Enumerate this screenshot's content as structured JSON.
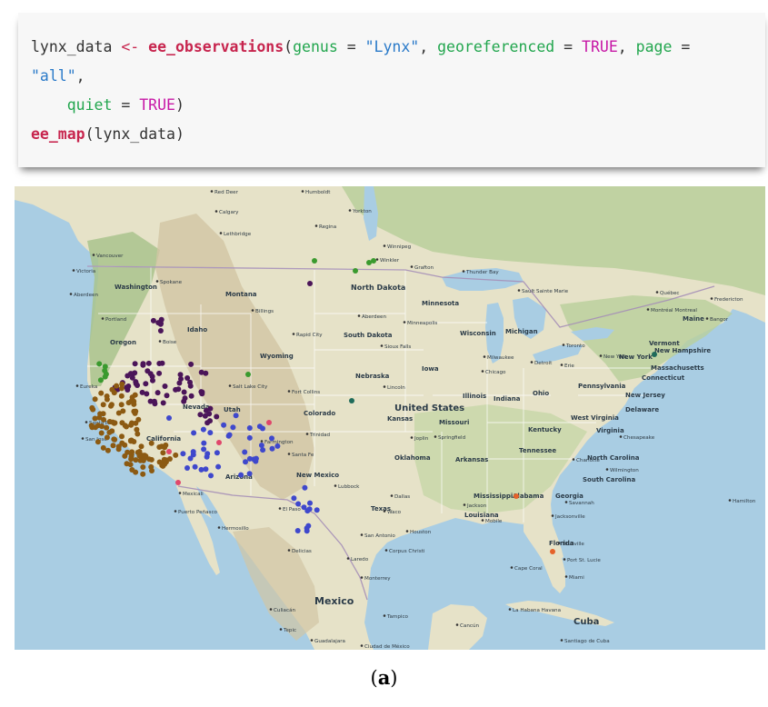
{
  "code": {
    "line1": {
      "var": "lynx_data ",
      "assign": "<-",
      "fn": " ee_observations",
      "open": "(",
      "arg1": "genus",
      "eq1": " = ",
      "val1": "\"Lynx\"",
      "sep1": ", ",
      "arg2": "georeferenced",
      "eq2": " = ",
      "val2": "TRUE",
      "sep2": ", ",
      "arg3": "page",
      "eq3": " ="
    },
    "line2": {
      "val3": "\"all\"",
      "sep": ","
    },
    "line3": {
      "indent": "    ",
      "arg4": "quiet",
      "eq4": " = ",
      "val4": "TRUE",
      "close": ")"
    },
    "line4": {
      "fn": "ee_map",
      "rest": "(lynx_data)"
    }
  },
  "caption": {
    "open": "(",
    "letter": "a",
    "close": ")"
  },
  "map": {
    "colors": {
      "water": "#a9cde3",
      "land": "#e6e2c8",
      "forest": "#b9cf9b",
      "mountain": "#d2c6a4",
      "cluster_purple": "#4b1559",
      "cluster_brown": "#8c5a12",
      "cluster_blue": "#3f48cc",
      "cluster_green": "#3a9a2e",
      "cluster_pink": "#e0476b",
      "cluster_orange": "#e5622a",
      "cluster_teal": "#1f6b5a"
    },
    "country_labels": [
      {
        "id": "us",
        "text": "United States"
      },
      {
        "id": "mexico",
        "text": "Mexico"
      },
      {
        "id": "cuba",
        "text": "Cuba"
      }
    ],
    "state_labels": [
      {
        "id": "washington",
        "text": "Washington"
      },
      {
        "id": "montana",
        "text": "Montana"
      },
      {
        "id": "oregon",
        "text": "Oregon"
      },
      {
        "id": "idaho",
        "text": "Idaho"
      },
      {
        "id": "wyoming",
        "text": "Wyoming"
      },
      {
        "id": "north-dakota",
        "text": "North Dakota"
      },
      {
        "id": "south-dakota",
        "text": "South Dakota"
      },
      {
        "id": "minnesota",
        "text": "Minnesota"
      },
      {
        "id": "wisconsin",
        "text": "Wisconsin"
      },
      {
        "id": "michigan",
        "text": "Michigan"
      },
      {
        "id": "nebraska",
        "text": "Nebraska"
      },
      {
        "id": "iowa",
        "text": "Iowa"
      },
      {
        "id": "illinois",
        "text": "Illinois"
      },
      {
        "id": "indiana",
        "text": "Indiana"
      },
      {
        "id": "ohio",
        "text": "Ohio"
      },
      {
        "id": "pennsylvania",
        "text": "Pennsylvania"
      },
      {
        "id": "new-york",
        "text": "New York"
      },
      {
        "id": "utah",
        "text": "Utah"
      },
      {
        "id": "colorado",
        "text": "Colorado"
      },
      {
        "id": "kansas",
        "text": "Kansas"
      },
      {
        "id": "missouri",
        "text": "Missouri"
      },
      {
        "id": "kentucky",
        "text": "Kentucky"
      },
      {
        "id": "west-virginia",
        "text": "West Virginia"
      },
      {
        "id": "virginia",
        "text": "Virginia"
      },
      {
        "id": "california",
        "text": "California"
      },
      {
        "id": "nevada",
        "text": "Nevada"
      },
      {
        "id": "arizona",
        "text": "Arizona"
      },
      {
        "id": "new-mexico",
        "text": "New Mexico"
      },
      {
        "id": "oklahoma",
        "text": "Oklahoma"
      },
      {
        "id": "arkansas",
        "text": "Arkansas"
      },
      {
        "id": "tennessee",
        "text": "Tennessee"
      },
      {
        "id": "north-carolina",
        "text": "North Carolina"
      },
      {
        "id": "south-carolina",
        "text": "South Carolina"
      },
      {
        "id": "mississippi",
        "text": "Mississippi"
      },
      {
        "id": "alabama",
        "text": "Alabama"
      },
      {
        "id": "georgia",
        "text": "Georgia"
      },
      {
        "id": "texas",
        "text": "Texas"
      },
      {
        "id": "louisiana",
        "text": "Louisiana"
      },
      {
        "id": "florida",
        "text": "Florida"
      },
      {
        "id": "massachusetts",
        "text": "Massachusetts"
      },
      {
        "id": "connecticut",
        "text": "Connecticut"
      },
      {
        "id": "new-jersey",
        "text": "New Jersey"
      },
      {
        "id": "delaware",
        "text": "Delaware"
      },
      {
        "id": "vermont",
        "text": "Vermont"
      },
      {
        "id": "new-hampshire",
        "text": "New Hampshire"
      },
      {
        "id": "maine",
        "text": "Maine"
      }
    ],
    "city_labels": [
      {
        "id": "red-deer",
        "text": "Red Deer"
      },
      {
        "id": "calgary",
        "text": "Calgary"
      },
      {
        "id": "lethbridge",
        "text": "Lethbridge"
      },
      {
        "id": "humboldt",
        "text": "Humboldt"
      },
      {
        "id": "yorkton",
        "text": "Yorkton"
      },
      {
        "id": "regina",
        "text": "Regina"
      },
      {
        "id": "winnipeg",
        "text": "Winnipeg"
      },
      {
        "id": "winkler",
        "text": "Winkler"
      },
      {
        "id": "grafton",
        "text": "Grafton"
      },
      {
        "id": "vancouver",
        "text": "Vancouver"
      },
      {
        "id": "victoria",
        "text": "Victoria"
      },
      {
        "id": "aberdeen-wa",
        "text": "Aberdeen"
      },
      {
        "id": "spokane",
        "text": "Spokane"
      },
      {
        "id": "portland",
        "text": "Portland"
      },
      {
        "id": "billings",
        "text": "Billings"
      },
      {
        "id": "boise",
        "text": "Boise"
      },
      {
        "id": "rapid-city",
        "text": "Rapid City"
      },
      {
        "id": "aberdeen-sd",
        "text": "Aberdeen"
      },
      {
        "id": "sioux-falls",
        "text": "Sioux Falls"
      },
      {
        "id": "minneapolis",
        "text": "Minneapolis"
      },
      {
        "id": "thunder-bay",
        "text": "Thunder Bay"
      },
      {
        "id": "sault-ste-marie",
        "text": "Sault Sainte Marie"
      },
      {
        "id": "quebec",
        "text": "Québec"
      },
      {
        "id": "fredericton",
        "text": "Fredericton"
      },
      {
        "id": "montreal",
        "text": "Montréal Montreal"
      },
      {
        "id": "bangor",
        "text": "Bangor"
      },
      {
        "id": "toronto",
        "text": "Toronto"
      },
      {
        "id": "detroit",
        "text": "Detroit"
      },
      {
        "id": "milwaukee",
        "text": "Milwaukee"
      },
      {
        "id": "chicago",
        "text": "Chicago"
      },
      {
        "id": "erie",
        "text": "Erie"
      },
      {
        "id": "new-york-city",
        "text": "New York"
      },
      {
        "id": "salt-lake-city",
        "text": "Salt Lake City"
      },
      {
        "id": "fort-collins",
        "text": "Fort Collins"
      },
      {
        "id": "lincoln",
        "text": "Lincoln"
      },
      {
        "id": "eureka",
        "text": "Eureka"
      },
      {
        "id": "santa-rosa",
        "text": "Santa Rosa"
      },
      {
        "id": "san-jose",
        "text": "San Jose"
      },
      {
        "id": "farmington",
        "text": "Farmington"
      },
      {
        "id": "trinidad",
        "text": "Trinidad"
      },
      {
        "id": "joplin",
        "text": "Joplin"
      },
      {
        "id": "springfield",
        "text": "Springfield"
      },
      {
        "id": "santa-fe",
        "text": "Santa Fe"
      },
      {
        "id": "lubbock",
        "text": "Lubbock"
      },
      {
        "id": "dallas",
        "text": "Dallas"
      },
      {
        "id": "waco",
        "text": "Waco"
      },
      {
        "id": "el-paso",
        "text": "El Paso"
      },
      {
        "id": "san-antonio",
        "text": "San Antonio"
      },
      {
        "id": "houston",
        "text": "Houston"
      },
      {
        "id": "corpus-christi",
        "text": "Corpus Christi"
      },
      {
        "id": "laredo",
        "text": "Laredo"
      },
      {
        "id": "monterrey",
        "text": "Monterrey"
      },
      {
        "id": "delicias",
        "text": "Delicias"
      },
      {
        "id": "hermosillo",
        "text": "Hermosillo"
      },
      {
        "id": "mexicali",
        "text": "Mexicali"
      },
      {
        "id": "puerto-penasco",
        "text": "Puerto Peñasco"
      },
      {
        "id": "mobile",
        "text": "Mobile"
      },
      {
        "id": "savannah",
        "text": "Savannah"
      },
      {
        "id": "jacksonville",
        "text": "Jacksonville"
      },
      {
        "id": "titusville",
        "text": "Titusville"
      },
      {
        "id": "port-st-lucie",
        "text": "Port St. Lucie"
      },
      {
        "id": "cape-coral",
        "text": "Cape Coral"
      },
      {
        "id": "miami",
        "text": "Miami"
      },
      {
        "id": "la-habana",
        "text": "La Habana Havana"
      },
      {
        "id": "cancun",
        "text": "Cancún"
      },
      {
        "id": "hamilton",
        "text": "Hamilton"
      },
      {
        "id": "charlotte",
        "text": "Charlotte"
      },
      {
        "id": "wilmington",
        "text": "Wilmington"
      },
      {
        "id": "chesapeake",
        "text": "Chesapeake"
      },
      {
        "id": "tampico",
        "text": "Tampico"
      },
      {
        "id": "culiacan",
        "text": "Culiacán"
      },
      {
        "id": "guadalajara",
        "text": "Guadalajara"
      },
      {
        "id": "ciudad-de-mexico",
        "text": "Ciudad de México"
      },
      {
        "id": "tepic",
        "text": "Tepic"
      },
      {
        "id": "santiago-de-cuba",
        "text": "Santiago de Cuba"
      },
      {
        "id": "jackson",
        "text": "Jackson"
      }
    ]
  }
}
